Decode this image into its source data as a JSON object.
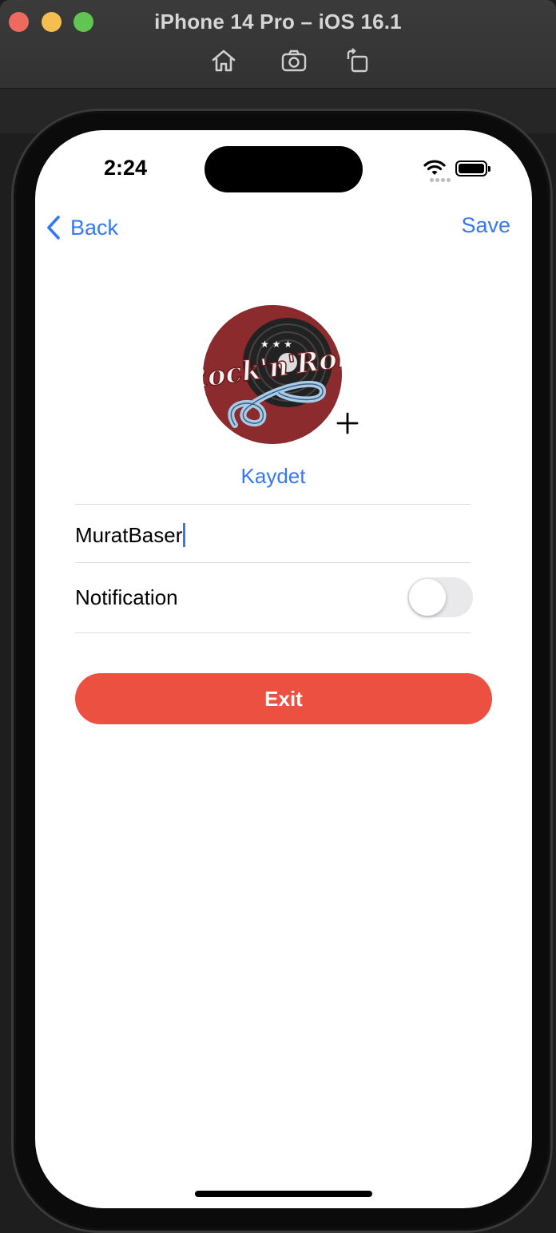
{
  "window": {
    "title": "iPhone 14 Pro – iOS 16.1",
    "toolbar_icons": [
      "home-icon",
      "screenshot-icon",
      "rotate-icon"
    ]
  },
  "status_bar": {
    "time": "2:24",
    "icons": [
      "cellular-dots-icon",
      "wifi-icon",
      "battery-icon"
    ]
  },
  "nav": {
    "back_label": "Back",
    "save_label": "Save"
  },
  "profile": {
    "avatar_logo_text": "Rock'n'Roll",
    "add_photo_icon": "plus-icon",
    "save_photo_label": "Kaydet"
  },
  "form": {
    "username_value": "MuratBaser",
    "notification_label": "Notification",
    "notification_enabled": false
  },
  "actions": {
    "exit_label": "Exit"
  },
  "colors": {
    "accent": "#3478f6",
    "exit_button": "#ec5040",
    "avatar_background": "#8c2b2e"
  }
}
